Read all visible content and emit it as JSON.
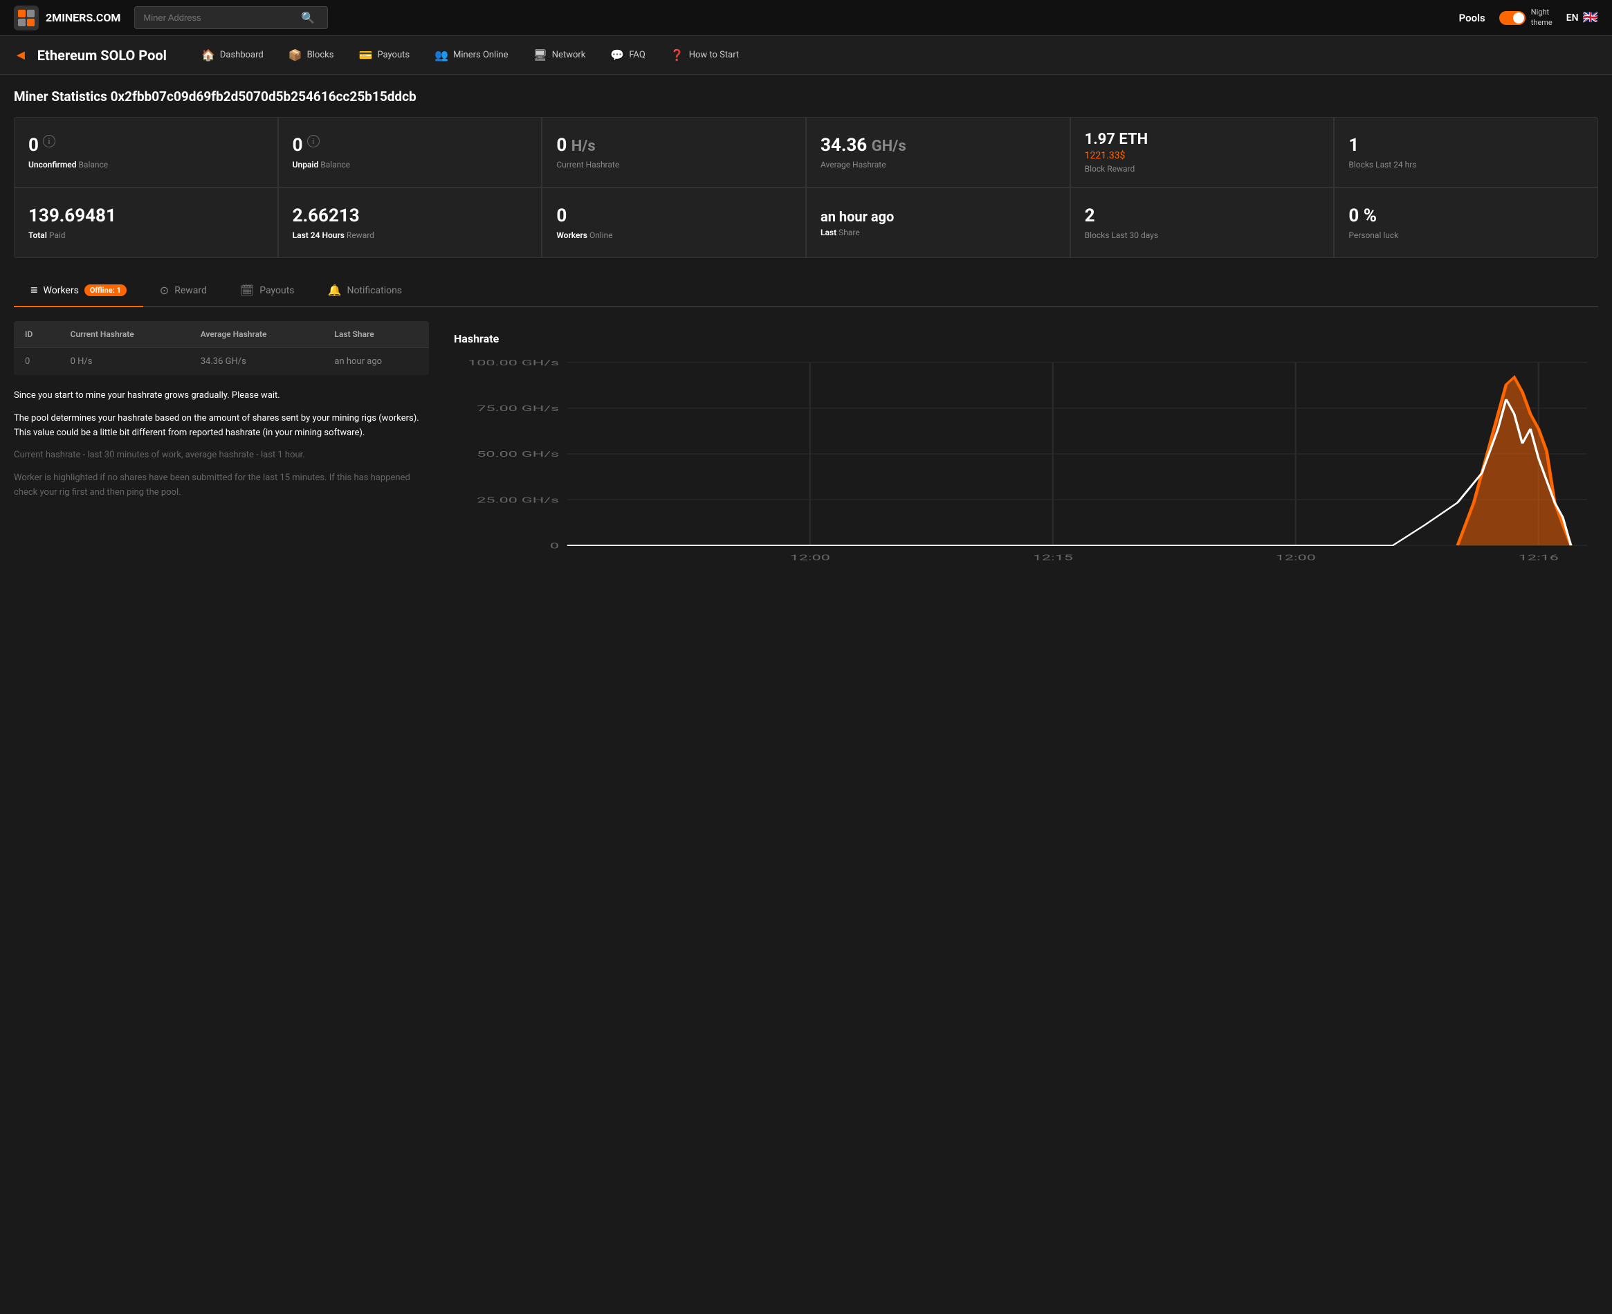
{
  "header": {
    "logo_text": "2MINERS.COM",
    "search_placeholder": "Miner Address",
    "pools_label": "Pools",
    "night_theme_label": "Night\ntheme",
    "lang": "EN"
  },
  "nav": {
    "pool_title": "Ethereum SOLO Pool",
    "items": [
      {
        "id": "dashboard",
        "label": "Dashboard",
        "icon": "🏠"
      },
      {
        "id": "blocks",
        "label": "Blocks",
        "icon": "📦"
      },
      {
        "id": "payouts",
        "label": "Payouts",
        "icon": "💳"
      },
      {
        "id": "miners-online",
        "label": "Miners Online",
        "icon": "👥"
      },
      {
        "id": "network",
        "label": "Network",
        "icon": "🖥"
      },
      {
        "id": "faq",
        "label": "FAQ",
        "icon": "💬"
      },
      {
        "id": "how-to-start",
        "label": "How to Start",
        "icon": "❓"
      }
    ]
  },
  "miner": {
    "title_prefix": "Miner Statistics ",
    "address": "0x2fbb07c09d69fb2d5070d5b254616cc25b15ddcb"
  },
  "stats": [
    {
      "id": "unconfirmed-balance",
      "value": "0",
      "label_bold": "Unconfirmed",
      "label_dim": " Balance",
      "has_info": true
    },
    {
      "id": "unpaid-balance",
      "value": "0",
      "label_bold": "Unpaid",
      "label_dim": " Balance",
      "has_info": true
    },
    {
      "id": "current-hashrate",
      "value": "0",
      "unit": " H/s",
      "label": "Current Hashrate"
    },
    {
      "id": "average-hashrate",
      "value": "34.36",
      "unit": " GH/s",
      "unit_color": "gray",
      "label": "Average Hashrate"
    },
    {
      "id": "block-reward",
      "value": "1.97 ETH",
      "sub_value": "1221.33$",
      "label": "Block Reward"
    },
    {
      "id": "blocks-last-24h",
      "value": "1",
      "label": "Blocks Last 24 hrs"
    },
    {
      "id": "total-paid",
      "value": "139.69481",
      "label_bold": "Total",
      "label_dim": " Paid"
    },
    {
      "id": "last-24h-reward",
      "value": "2.66213",
      "label_bold": "Last 24 Hours",
      "label_dim": " Reward"
    },
    {
      "id": "workers-online",
      "value": "0",
      "label_bold": "Workers",
      "label_dim": " Online"
    },
    {
      "id": "last-share",
      "value": "an hour ago",
      "label_bold": "Last",
      "label_dim": " Share"
    },
    {
      "id": "blocks-last-30d",
      "value": "2",
      "label": "Blocks Last 30 days"
    },
    {
      "id": "personal-luck",
      "value": "0 %",
      "label": "Personal luck"
    }
  ],
  "tabs": [
    {
      "id": "workers",
      "label": "Workers",
      "icon": "≡",
      "active": true,
      "badge": "Offline: 1"
    },
    {
      "id": "reward",
      "label": "Reward",
      "icon": "⊙"
    },
    {
      "id": "payouts",
      "label": "Payouts",
      "icon": "🗓"
    },
    {
      "id": "notifications",
      "label": "Notifications",
      "icon": "🔔"
    }
  ],
  "workers_table": {
    "columns": [
      "ID",
      "Current Hashrate",
      "Average Hashrate",
      "Last Share"
    ],
    "rows": [
      {
        "id": "0",
        "current_hashrate": "0 H/s",
        "average_hashrate": "34.36 GH/s",
        "last_share": "an hour ago"
      }
    ]
  },
  "info_texts": [
    "Since you start to mine your hashrate grows gradually. Please wait.",
    "The pool determines your hashrate based on the amount of shares sent by your mining rigs (workers). This value could be a little bit different from reported hashrate (in your mining software).",
    "Current hashrate - last 30 minutes of work, average hashrate - last 1 hour.",
    "Worker is highlighted if no shares have been submitted for the last 15 minutes. If this has happened check your rig first and then ping the pool."
  ],
  "chart": {
    "title": "Hashrate",
    "y_labels": [
      "100.00 GH/s",
      "75.00 GH/s",
      "50.00 GH/s",
      "25.00 GH/s",
      "0"
    ],
    "x_labels": [
      "12:00",
      "12:15",
      "12:00",
      "12:16"
    ],
    "colors": {
      "orange": "#ff6600",
      "white": "#ffffff",
      "grid": "#2a2a2a"
    }
  }
}
